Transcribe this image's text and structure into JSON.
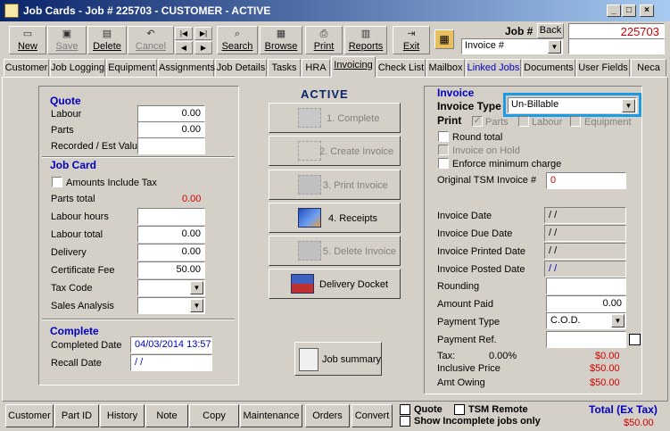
{
  "window": {
    "title": "Job Cards - Job # 225703 - CUSTOMER - ACTIVE",
    "min": "_",
    "max": "□",
    "close": "×"
  },
  "toolbar": {
    "new": "New",
    "save": "Save",
    "delete": "Delete",
    "cancel": "Cancel",
    "search": "Search",
    "browse": "Browse",
    "print": "Print",
    "reports": "Reports",
    "exit": "Exit",
    "job_label": "Job #",
    "back": "Back",
    "job_number": "225703",
    "search_by": "Invoice #"
  },
  "tabs": [
    "Customer",
    "Job Logging",
    "Equipment",
    "Assignments",
    "Job Details",
    "Tasks",
    "HRA",
    "Invoicing",
    "Check List",
    "Mailbox",
    "Linked Jobs",
    "Documents",
    "User Fields",
    "Neca"
  ],
  "status": "ACTIVE",
  "quote": {
    "heading": "Quote",
    "labour_label": "Labour",
    "labour": "0.00",
    "parts_label": "Parts",
    "parts": "0.00",
    "recorded_label": "Recorded / Est Value",
    "recorded": ""
  },
  "jobcard": {
    "heading": "Job Card",
    "amounts_inc_tax": "Amounts Include Tax",
    "parts_total_label": "Parts total",
    "parts_total": "0.00",
    "labour_hours_label": "Labour hours",
    "labour_hours": "",
    "labour_total_label": "Labour total",
    "labour_total": "0.00",
    "delivery_label": "Delivery",
    "delivery": "0.00",
    "cert_fee_label": "Certificate Fee",
    "cert_fee": "50.00",
    "tax_code_label": "Tax Code",
    "tax_code": "",
    "sales_analysis_label": "Sales Analysis",
    "sales_analysis": ""
  },
  "complete": {
    "heading": "Complete",
    "completed_date_label": "Completed Date",
    "completed_date": "04/03/2014 13:57",
    "recall_date_label": "Recall Date",
    "recall_date": " / /"
  },
  "actions": {
    "complete": "1. Complete",
    "create_invoice": "2. Create Invoice",
    "print_invoice": "3. Print Invoice",
    "receipts": "4. Receipts",
    "delete_invoice": "5. Delete Invoice",
    "delivery_docket": "Delivery Docket",
    "job_summary": "Job summary"
  },
  "invoice": {
    "heading": "Invoice",
    "type_label": "Invoice Type",
    "type": "Un-Billable",
    "print_label": "Print",
    "print_parts": "Parts",
    "print_labour": "Labour",
    "print_equipment": "Equipment",
    "round_total": "Round total",
    "invoice_on_hold": "Invoice on Hold",
    "enforce_min": "Enforce minimum charge",
    "orig_tsm_label": "Original TSM Invoice #",
    "orig_tsm": "0",
    "invoice_date_label": "Invoice Date",
    "invoice_date": " / /",
    "due_date_label": "Invoice Due Date",
    "due_date": " / /",
    "printed_date_label": "Invoice Printed Date",
    "printed_date": " / /",
    "posted_date_label": "Invoice Posted Date",
    "posted_date": " / /",
    "rounding_label": "Rounding",
    "rounding": "",
    "amount_paid_label": "Amount Paid",
    "amount_paid": "0.00",
    "payment_type_label": "Payment Type",
    "payment_type": "C.O.D.",
    "payment_ref_label": "Payment Ref.",
    "payment_ref": "",
    "tax_label": "Tax:",
    "tax_rate": "0.00%",
    "tax_amount": "$0.00",
    "inclusive_label": "Inclusive Price",
    "inclusive": "$50.00",
    "owing_label": "Amt Owing",
    "owing": "$50.00"
  },
  "bottom": {
    "buttons": [
      "Customer",
      "Part ID",
      "History",
      "Note",
      "Copy",
      "Maintenance",
      "Orders",
      "Convert"
    ],
    "quote": "Quote",
    "tsm_remote": "TSM Remote",
    "show_incomplete": "Show Incomplete jobs only",
    "total_label": "Total (Ex Tax)",
    "total": "$50.00"
  },
  "colors": {
    "accent_blue": "#0000c0",
    "red": "#d00000",
    "title_dark": "#0a246a",
    "highlight": "#1a9be6"
  }
}
